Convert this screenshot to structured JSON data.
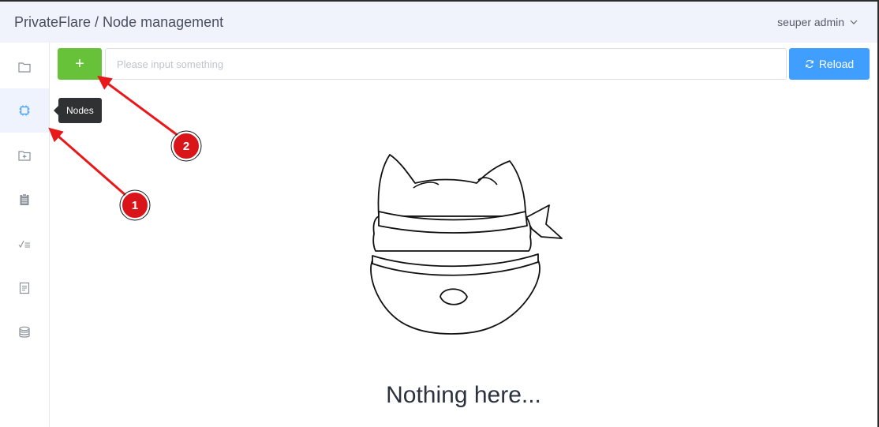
{
  "header": {
    "app_name": "PrivateFlare",
    "separator": "/",
    "page_name": "Node management",
    "user": "seuper admin"
  },
  "sidebar": {
    "items": [
      {
        "icon": "folder-icon"
      },
      {
        "icon": "chip-icon",
        "active": true
      },
      {
        "icon": "folder-add-icon"
      },
      {
        "icon": "clipboard-icon"
      },
      {
        "icon": "checklist-icon"
      },
      {
        "icon": "document-icon"
      },
      {
        "icon": "database-icon"
      }
    ],
    "tooltip": "Nodes"
  },
  "toolbar": {
    "add_label": "+",
    "search_placeholder": "Please input something",
    "search_value": "",
    "reload_label": "Reload"
  },
  "empty_state": {
    "message": "Nothing here..."
  },
  "annotations": [
    {
      "label": "1"
    },
    {
      "label": "2"
    }
  ],
  "colors": {
    "header_bg": "#f0f3fb",
    "add_button": "#67c23a",
    "reload_button": "#409eff",
    "tooltip_bg": "#303133",
    "arrow": "#e8191a",
    "badge": "#d9151a",
    "active_icon": "#409eff"
  }
}
